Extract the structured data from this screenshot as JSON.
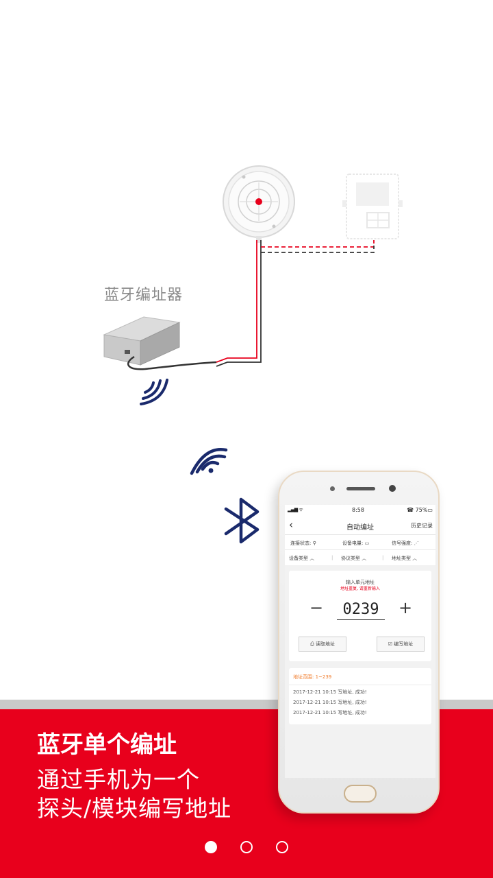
{
  "illustration": {
    "device_label": "蓝牙编址器"
  },
  "headline": "蓝牙单个编址",
  "subtitle": {
    "line1": "通过手机为一个",
    "line2": "探头/模块编写地址"
  },
  "pager": {
    "count": 3,
    "active": 0
  },
  "colors": {
    "brand_red": "#e8001c",
    "bluetooth_navy": "#1a2a6c"
  },
  "icons": [
    "bluetooth-icon",
    "wifi-wave-icon",
    "back-arrow-icon"
  ],
  "phone": {
    "status": {
      "signal": "▂▄▆ ᯤ",
      "time": "8:58",
      "battery": "☎ 75%▭"
    },
    "nav": {
      "back": "‹",
      "title": "自动编址",
      "history": "历史记录"
    },
    "info_row": [
      "连接状态: ⚲",
      "设备电量: ▭",
      "信号强度: ⋰"
    ],
    "selectors": [
      "设备类型 ︿",
      "协议类型 ︿",
      "地址类型 ︿"
    ],
    "input_hint": "输入单元地址",
    "input_warn": "地址重复, 请重新输入",
    "minus": "−",
    "plus": "+",
    "address": "0239",
    "read_button": "⎙ 读取地址",
    "write_button": "☑ 编写地址",
    "range_label": "地址范围: 1~239",
    "logs": [
      "2017-12-21  10:15  写地址, 成功!",
      "2017-12-21  10:15  写地址, 成功!",
      "2017-12-21  10:15  写地址, 成功!"
    ]
  }
}
